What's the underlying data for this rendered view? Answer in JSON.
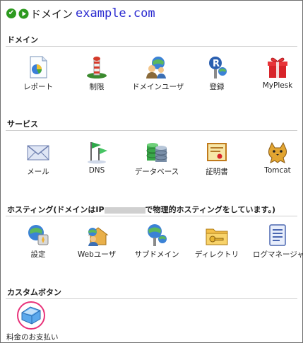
{
  "title": {
    "text": "ドメイン",
    "domain": "example.com"
  },
  "sections": {
    "domain": {
      "heading": "ドメイン",
      "items": [
        {
          "label": "レポート",
          "icon": "report-icon"
        },
        {
          "label": "制限",
          "icon": "limits-icon"
        },
        {
          "label": "ドメインユーザ",
          "icon": "domain-users-icon"
        },
        {
          "label": "登録",
          "icon": "register-icon"
        },
        {
          "label": "MyPlesk",
          "icon": "myplesk-gift-icon"
        }
      ]
    },
    "services": {
      "heading": "サービス",
      "items": [
        {
          "label": "メール",
          "icon": "mail-icon"
        },
        {
          "label": "DNS",
          "icon": "dns-flags-icon"
        },
        {
          "label": "データベース",
          "icon": "database-icon"
        },
        {
          "label": "証明書",
          "icon": "certificate-icon"
        },
        {
          "label": "Tomcat",
          "icon": "tomcat-icon"
        }
      ]
    },
    "hosting": {
      "heading_prefix": "ホスティング(ドメインはIP",
      "heading_suffix": "で物理的ホスティングをしています。)",
      "items": [
        {
          "label": "設定",
          "icon": "settings-icon"
        },
        {
          "label": "Webユーザ",
          "icon": "web-users-icon"
        },
        {
          "label": "サブドメイン",
          "icon": "subdomains-icon"
        },
        {
          "label": "ディレクトリ",
          "icon": "directories-icon"
        },
        {
          "label": "ログマネージャ",
          "icon": "log-manager-icon"
        }
      ]
    },
    "custom": {
      "heading": "カスタムボタン",
      "items": [
        {
          "label": "料金のお支払い",
          "icon": "custom-button-icon"
        }
      ]
    }
  },
  "colors": {
    "domain_text": "#2a2ad0",
    "highlight_circle": "#e8337a",
    "check_green": "#2d9a1f"
  }
}
